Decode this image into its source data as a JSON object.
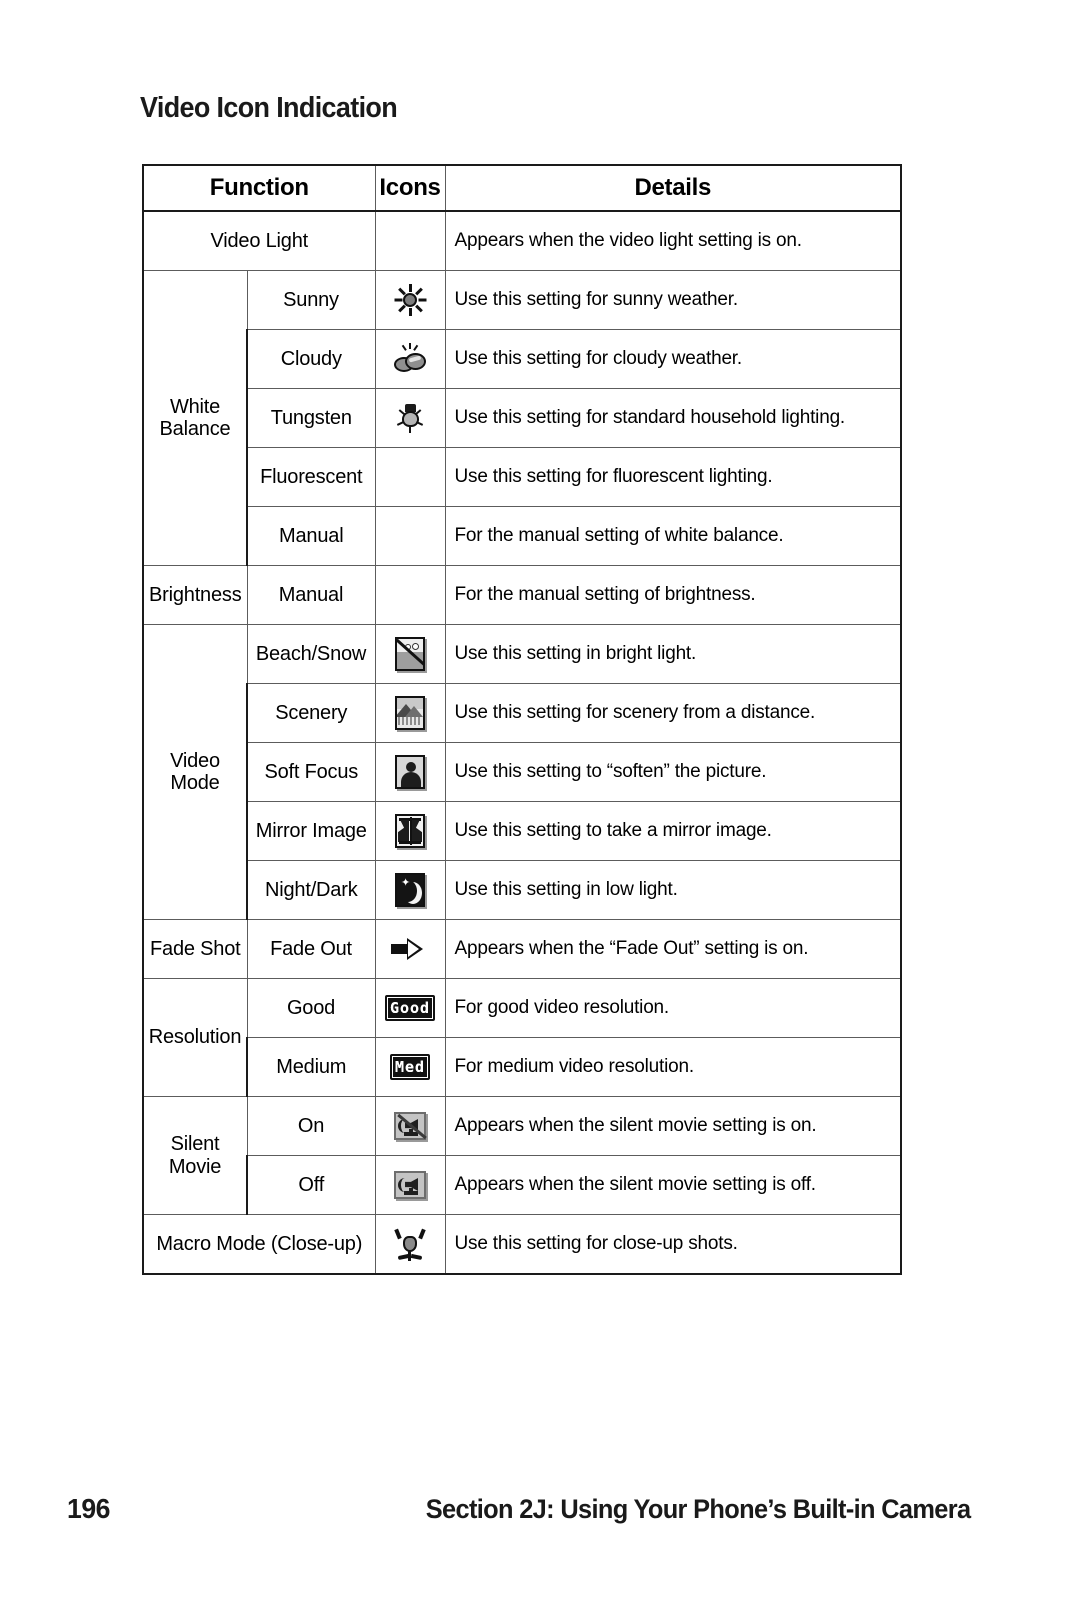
{
  "page": {
    "title": "Video Icon Indication",
    "number": "196",
    "section": "Section 2J: Using Your Phone’s Built-in Camera"
  },
  "table": {
    "headers": {
      "function": "Function",
      "icons": "Icons",
      "details": "Details"
    },
    "rows": [
      {
        "function": "Video Light",
        "sub": "",
        "icon": "",
        "details": "Appears when the video light setting is on."
      },
      {
        "function": "White Balance",
        "sub": "Sunny",
        "icon": "sun-icon",
        "details": "Use this setting for sunny weather."
      },
      {
        "function": "",
        "sub": "Cloudy",
        "icon": "cloud-icon",
        "details": "Use this setting for cloudy weather."
      },
      {
        "function": "",
        "sub": "Tungsten",
        "icon": "lightbulb-icon",
        "details": "Use this setting for standard household lighting."
      },
      {
        "function": "",
        "sub": "Fluorescent",
        "icon": "",
        "details": "Use this setting for fluorescent lighting."
      },
      {
        "function": "",
        "sub": "Manual",
        "icon": "",
        "details": "For the manual setting of white balance."
      },
      {
        "function": "Brightness",
        "sub": "Manual",
        "icon": "",
        "details": "For the manual setting of brightness."
      },
      {
        "function": "Video Mode",
        "sub": "Beach/Snow",
        "icon": "beach-snow-icon",
        "details": "Use this setting in bright light."
      },
      {
        "function": "",
        "sub": "Scenery",
        "icon": "scenery-icon",
        "details": "Use this setting for scenery from a distance."
      },
      {
        "function": "",
        "sub": "Soft Focus",
        "icon": "soft-focus-icon",
        "details": "Use this setting to “soften” the picture."
      },
      {
        "function": "",
        "sub": "Mirror Image",
        "icon": "mirror-image-icon",
        "details": "Use this setting to take a mirror image."
      },
      {
        "function": "",
        "sub": "Night/Dark",
        "icon": "night-dark-icon",
        "details": "Use this setting in low light."
      },
      {
        "function": "Fade Shot",
        "sub": "Fade Out",
        "icon": "fade-out-arrow-icon",
        "details": "Appears when the “Fade Out” setting is on."
      },
      {
        "function": "Resolution",
        "sub": "Good",
        "icon": "good-badge-icon",
        "icon_text": "Good",
        "details": "For good video resolution."
      },
      {
        "function": "",
        "sub": "Medium",
        "icon": "med-badge-icon",
        "icon_text": "Med",
        "details": "For medium video resolution."
      },
      {
        "function": "Silent Movie",
        "sub": "On",
        "icon": "speaker-muted-icon",
        "details": "Appears when the silent movie setting is on."
      },
      {
        "function": "",
        "sub": "Off",
        "icon": "speaker-on-icon",
        "details": "Appears when the silent movie setting is off."
      },
      {
        "function": "Macro Mode (Close-up)",
        "sub": "",
        "icon": "flower-macro-icon",
        "details": "Use this setting for close-up shots."
      }
    ],
    "group_labels": {
      "white_balance_line1": "White",
      "white_balance_line2": "Balance",
      "brightness": "Brightness",
      "video_mode_line1": "Video",
      "video_mode_line2": "Mode",
      "fade_shot": "Fade Shot",
      "resolution": "Resolution",
      "silent_movie_line1": "Silent",
      "silent_movie_line2": "Movie",
      "macro": "Macro Mode (Close-up)",
      "video_light": "Video Light"
    }
  },
  "colors": {
    "text": "#1a1a1a",
    "border_heavy": "#1a1a1a",
    "border_light": "#5c5c5c",
    "background": "#ffffff"
  }
}
